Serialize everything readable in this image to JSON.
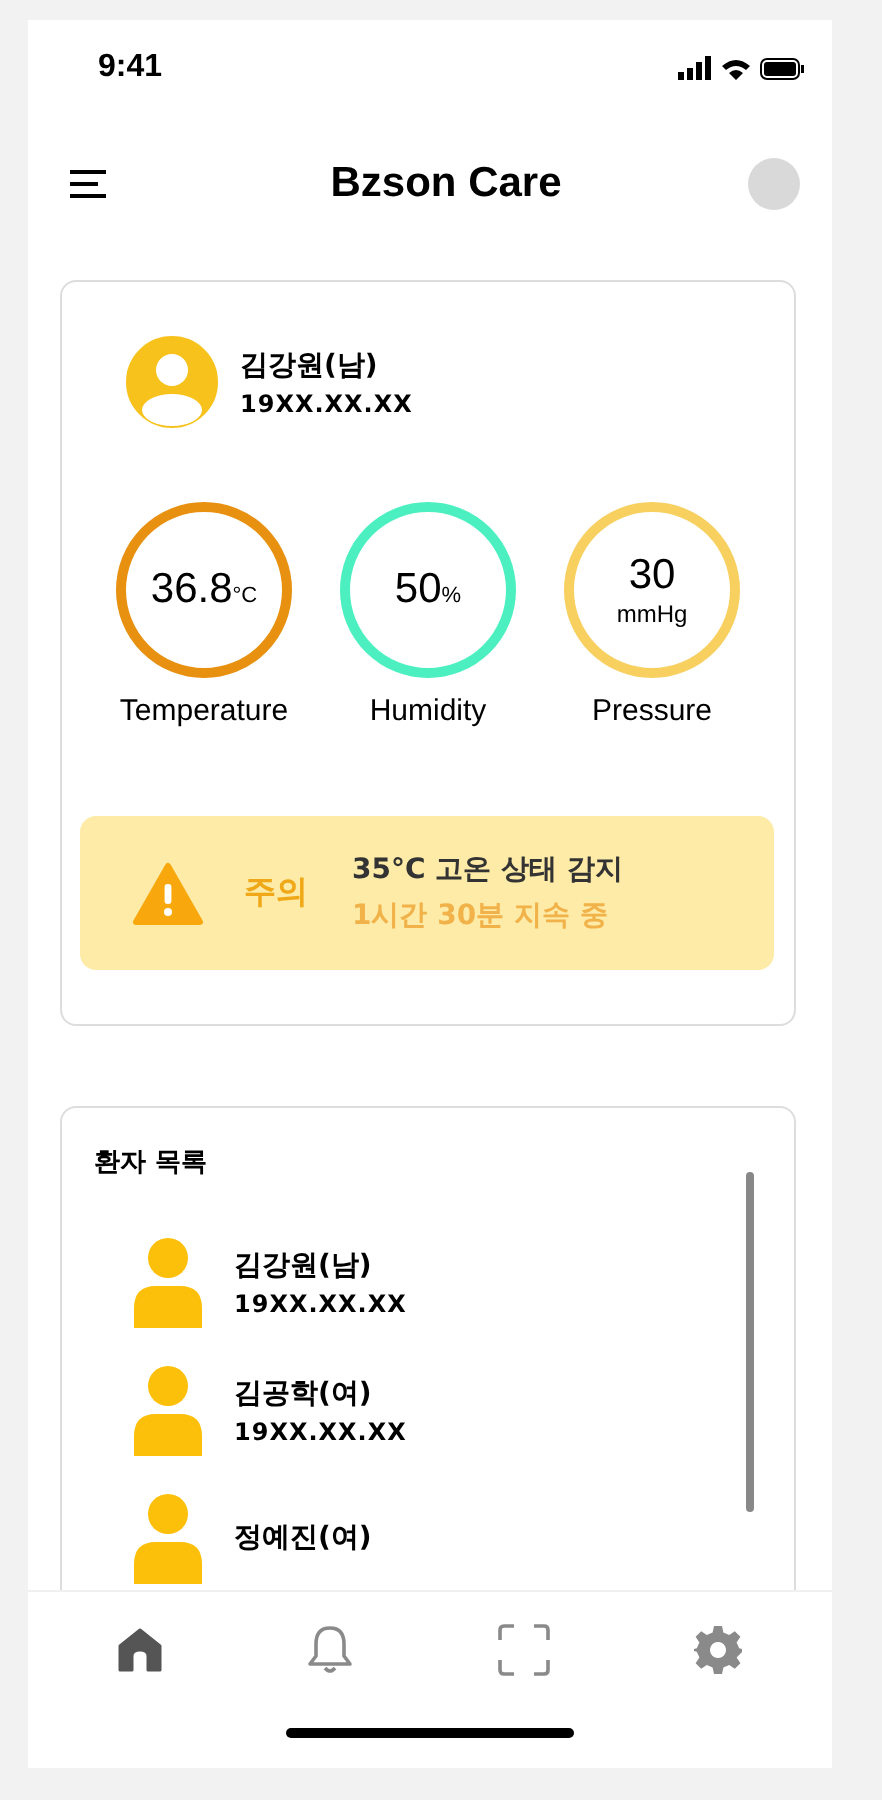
{
  "status_bar": {
    "time": "9:41"
  },
  "header": {
    "title": "Bzson Care"
  },
  "current_patient": {
    "name": "김강원(남)",
    "birth": "19XX.XX.XX"
  },
  "metrics": [
    {
      "value": "36.8",
      "unit": "°C",
      "label": "Temperature",
      "color": "#e8900f",
      "unit_below": false
    },
    {
      "value": "50",
      "unit": "%",
      "label": "Humidity",
      "color": "#4cf0c0",
      "unit_below": false
    },
    {
      "value": "30",
      "unit": "mmHg",
      "label": "Pressure",
      "color": "#f8d060",
      "unit_below": true
    }
  ],
  "alert": {
    "label": "주의",
    "title": "35°C 고온 상태 감지",
    "detail": "1시간 30분 지속 중"
  },
  "patient_list": {
    "title": "환자 목록",
    "patients": [
      {
        "name": "김강원(남)",
        "birth": "19XX.XX.XX"
      },
      {
        "name": "김공학(여)",
        "birth": "19XX.XX.XX"
      },
      {
        "name": "정예진(여)"
      }
    ]
  },
  "nav": [
    {
      "kind": "home",
      "selected": true
    },
    {
      "kind": "bell",
      "selected": false
    },
    {
      "kind": "scan",
      "selected": false
    },
    {
      "kind": "settings",
      "selected": false
    }
  ]
}
